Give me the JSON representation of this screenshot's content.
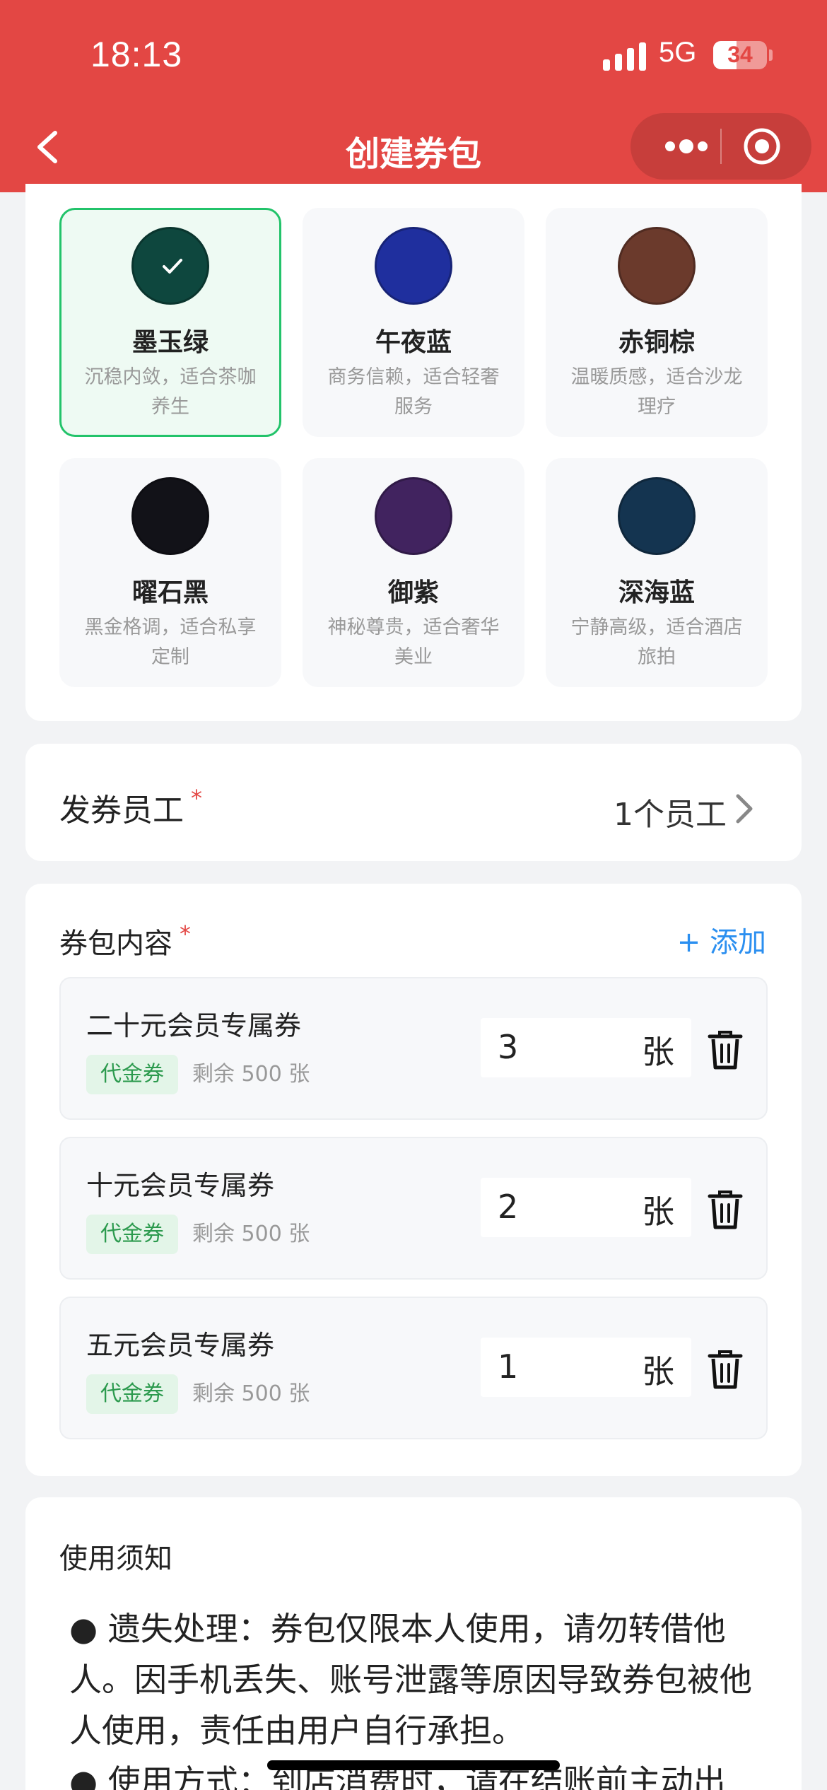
{
  "status_bar": {
    "time": "18:13",
    "network": "5G",
    "battery": "34"
  },
  "nav": {
    "title": "创建券包"
  },
  "themes": [
    {
      "name": "墨玉绿",
      "desc": "沉稳内敛，适合茶咖养生",
      "color": "#0e473e",
      "selected": true
    },
    {
      "name": "午夜蓝",
      "desc": "商务信赖，适合轻奢服务",
      "color": "#1f2f9e",
      "selected": false
    },
    {
      "name": "赤铜棕",
      "desc": "温暖质感，适合沙龙理疗",
      "color": "#6b3a2c",
      "selected": false
    },
    {
      "name": "曜石黑",
      "desc": "黑金格调，适合私享定制",
      "color": "#121218",
      "selected": false
    },
    {
      "name": "御紫",
      "desc": "神秘尊贵，适合奢华美业",
      "color": "#41235f",
      "selected": false
    },
    {
      "name": "深海蓝",
      "desc": "宁静高级，适合酒店旅拍",
      "color": "#143450",
      "selected": false
    }
  ],
  "staff": {
    "label": "发券员工",
    "required_mark": "*",
    "value": "1个员工"
  },
  "package": {
    "label": "券包内容",
    "required_mark": "*",
    "add_label": "+ 添加",
    "items": [
      {
        "name": "二十元会员专属券",
        "tag": "代金券",
        "remain": "剩余 500 张",
        "qty": "3",
        "unit": "张"
      },
      {
        "name": "十元会员专属券",
        "tag": "代金券",
        "remain": "剩余 500 张",
        "qty": "2",
        "unit": "张"
      },
      {
        "name": "五元会员专属券",
        "tag": "代金券",
        "remain": "剩余 500 张",
        "qty": "1",
        "unit": "张"
      }
    ]
  },
  "notice": {
    "title": "使用须知",
    "items": [
      "● 遗失处理：券包仅限本人使用，请勿转借他人。因手机丢失、账号泄露等原因导致券包被他人使用，责任由用户自行承担。",
      "● 使用方式：到店消费时，请在结账前主动出"
    ]
  }
}
